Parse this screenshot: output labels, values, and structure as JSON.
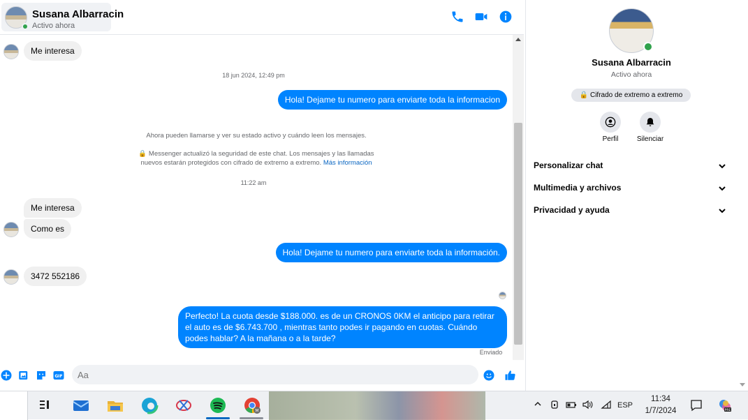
{
  "header": {
    "name": "Susana Albarracin",
    "status": "Activo ahora"
  },
  "messages": {
    "m1": "Me interesa",
    "stamp1": "18 jun 2024, 12:49 pm",
    "m2": "Hola! Dejame tu numero  para enviarte toda la informacion",
    "sys1": "Ahora pueden llamarse y ver su estado activo y cuándo leen los mensajes.",
    "sys2_line1": "Messenger actualizó la seguridad de este chat. Los mensajes y las llamadas",
    "sys2_line2": "nuevos estarán protegidos con cifrado de extremo a extremo.",
    "sys2_link": "Más información",
    "stamp2": "11:22 am",
    "m3": "Me interesa",
    "m4": "Como es",
    "m5": "Hola! Dejame tu numero  para enviarte toda la información.",
    "m6": "3472 552186",
    "m7": "Perfecto! La cuota desde $188.000. es de un CRONOS 0KM el anticipo para retirar el auto es de $6.743.700 , mientras tanto podes ir pagando en cuotas. Cuándo podes hablar? A la mañana o a la tarde?",
    "sent_status": "Enviado"
  },
  "composer": {
    "placeholder": "Aa"
  },
  "side": {
    "name": "Susana Albarracin",
    "status": "Activo ahora",
    "e2e": "Cifrado de extremo a extremo",
    "profile_label": "Perfil",
    "mute_label": "Silenciar",
    "rows": [
      "Personalizar chat",
      "Multimedia y archivos",
      "Privacidad y ayuda"
    ]
  },
  "taskbar": {
    "lang": "ESP",
    "time": "11:34",
    "date": "1/7/2024",
    "apps": [
      "widgets-icon",
      "mail-icon",
      "file-explorer-icon",
      "edge-icon",
      "snipping-tool-icon",
      "spotify-icon",
      "chrome-icon"
    ]
  },
  "colors": {
    "accent": "#0084ff",
    "incoming": "#f0f0f0",
    "online": "#31a24c"
  }
}
